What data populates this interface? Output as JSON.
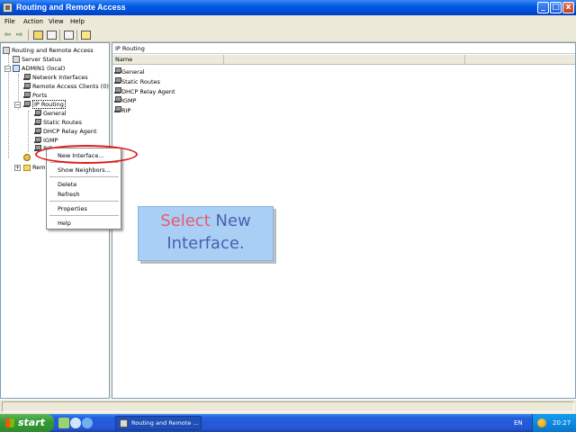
{
  "window": {
    "title": "Routing and Remote Access",
    "controls": {
      "minimize": "_",
      "maximize": "□",
      "close": "x"
    }
  },
  "menu": {
    "items": [
      {
        "label": "File"
      },
      {
        "label": "Action"
      },
      {
        "label": "View"
      },
      {
        "label": "Help"
      }
    ]
  },
  "toolbar": {
    "buttons": [
      "back-icon",
      "forward-icon",
      "up-folder-icon",
      "show-hide-tree-icon",
      "export-list-icon",
      "help-icon"
    ]
  },
  "tree": {
    "root": "Routing and Remote Access",
    "server_status": "Server Status",
    "server": "ADMIN1 (local)",
    "network_interfaces": "Network Interfaces",
    "remote_access_clients": "Remote Access Clients (0)",
    "ports": "Ports",
    "ip_routing": "IP Routing",
    "general": "General",
    "static_routes": "Static Routes",
    "dhcp_relay": "DHCP Relay Agent",
    "igmp": "IGMP",
    "rip": "RIP",
    "remote_truncated": "Rem"
  },
  "right_pane": {
    "header": "IP Routing",
    "column_name": "Name",
    "items": [
      {
        "label": "General"
      },
      {
        "label": "Static Routes"
      },
      {
        "label": "DHCP Relay Agent"
      },
      {
        "label": "IGMP"
      },
      {
        "label": "RIP"
      }
    ]
  },
  "context_menu": {
    "new_interface": "New Interface...",
    "show_neighbors": "Show Neighbors...",
    "delete": "Delete",
    "refresh": "Refresh",
    "properties": "Properties",
    "help": "Help"
  },
  "callout": {
    "word1": "Select",
    "word2": "New",
    "line2": "Interface.",
    "color_select": "#e85a70",
    "color_rest": "#4a5fb0"
  },
  "taskbar": {
    "start_label": "start",
    "task_label": "Routing and Remote ...",
    "language": "EN",
    "clock": "20:27"
  },
  "colors": {
    "titlebar": "#0058e6",
    "highlight_ellipse": "#e01b1b",
    "callout_bg": "#a9cff4"
  }
}
